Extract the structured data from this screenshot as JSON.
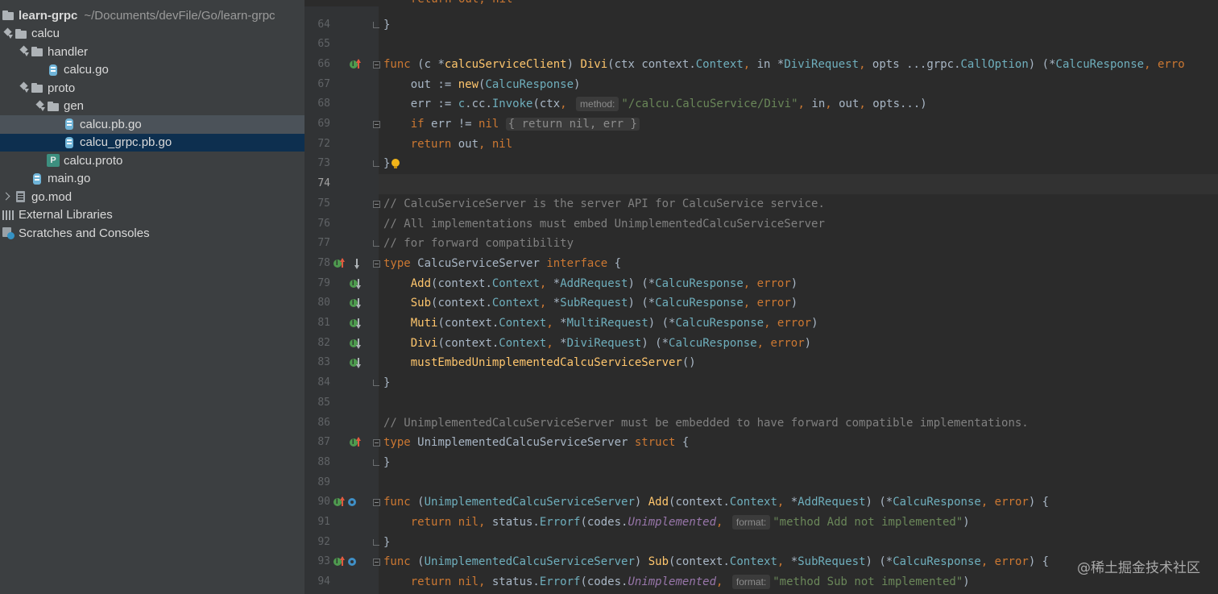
{
  "project": {
    "root_name": "learn-grpc",
    "root_path": "~/Documents/devFile/Go/learn-grpc",
    "tree": [
      {
        "label": "calcu",
        "kind": "folder",
        "arrow": "down",
        "depth": 0
      },
      {
        "label": "handler",
        "kind": "folder",
        "arrow": "down",
        "depth": 1
      },
      {
        "label": "calcu.go",
        "kind": "go",
        "arrow": "",
        "depth": 2
      },
      {
        "label": "proto",
        "kind": "folder",
        "arrow": "down",
        "depth": 1
      },
      {
        "label": "gen",
        "kind": "folder",
        "arrow": "down",
        "depth": 2
      },
      {
        "label": "calcu.pb.go",
        "kind": "go",
        "arrow": "",
        "depth": 3,
        "state": "sel-light"
      },
      {
        "label": "calcu_grpc.pb.go",
        "kind": "go",
        "arrow": "",
        "depth": 3,
        "state": "sel"
      },
      {
        "label": "calcu.proto",
        "kind": "proto",
        "arrow": "",
        "depth": 2
      },
      {
        "label": "main.go",
        "kind": "go",
        "arrow": "",
        "depth": 1
      },
      {
        "label": "go.mod",
        "kind": "mod",
        "arrow": "right",
        "depth": 0
      },
      {
        "label": "External Libraries",
        "kind": "lib",
        "arrow": "",
        "depth": -1
      },
      {
        "label": "Scratches and Consoles",
        "kind": "scratch",
        "arrow": "",
        "depth": -1
      }
    ]
  },
  "editor": {
    "top_partial": "return out, nil",
    "lines": [
      {
        "n": "64",
        "g": [],
        "fold": "end",
        "code": [
          [
            "p",
            "}"
          ]
        ]
      },
      {
        "n": "65",
        "g": [],
        "code": []
      },
      {
        "n": "66",
        "g": [
          "impl",
          "up"
        ],
        "fold": "open",
        "code": [
          [
            "kw",
            "func "
          ],
          [
            "p",
            "(c *"
          ],
          [
            "fn",
            "calcuServiceClient"
          ],
          [
            "p",
            ") "
          ],
          [
            "fn",
            "Divi"
          ],
          [
            "p",
            "(ctx context."
          ],
          [
            "ty",
            "Context"
          ],
          [
            "kw",
            ", "
          ],
          [
            "p",
            "in *"
          ],
          [
            "ty",
            "DiviRequest"
          ],
          [
            "kw",
            ", "
          ],
          [
            "p",
            "opts ...grpc."
          ],
          [
            "ty",
            "CallOption"
          ],
          [
            "p",
            ") (*"
          ],
          [
            "ty",
            "CalcuResponse"
          ],
          [
            "kw",
            ", erro"
          ]
        ]
      },
      {
        "n": "67",
        "g": [],
        "code": [
          [
            "p",
            "    out := "
          ],
          [
            "fn",
            "new"
          ],
          [
            "p",
            "("
          ],
          [
            "ty",
            "CalcuResponse"
          ],
          [
            "p",
            ")"
          ]
        ]
      },
      {
        "n": "68",
        "g": [],
        "code": [
          [
            "p",
            "    err := "
          ],
          [
            "ty",
            "c"
          ],
          [
            "p",
            ".cc."
          ],
          [
            "ty",
            "Invoke"
          ],
          [
            "p",
            "(ctx"
          ],
          [
            "kw",
            ", "
          ],
          [
            "hint",
            "method:"
          ],
          [
            "st",
            "\"/calcu.CalcuService/Divi\""
          ],
          [
            "kw",
            ", "
          ],
          [
            "p",
            "in"
          ],
          [
            "kw",
            ", "
          ],
          [
            "p",
            "out"
          ],
          [
            "kw",
            ", "
          ],
          [
            "p",
            "opts...)"
          ]
        ]
      },
      {
        "n": "69",
        "g": [],
        "fold": "open",
        "code": [
          [
            "kw",
            "    if "
          ],
          [
            "p",
            "err != "
          ],
          [
            "kw",
            "nil "
          ],
          [
            "fold",
            "{ return nil, err }"
          ]
        ]
      },
      {
        "n": "72",
        "g": [],
        "code": [
          [
            "kw",
            "    return "
          ],
          [
            "p",
            "out"
          ],
          [
            "kw",
            ", nil"
          ]
        ]
      },
      {
        "n": "73",
        "g": [],
        "fold": "end",
        "bulb": true,
        "code": [
          [
            "p",
            "}"
          ]
        ]
      },
      {
        "n": "74",
        "g": [],
        "caret": true,
        "code": []
      },
      {
        "n": "75",
        "g": [],
        "fold": "open",
        "code": [
          [
            "cm",
            "// CalcuServiceServer is the server API for CalcuService service."
          ]
        ]
      },
      {
        "n": "76",
        "g": [],
        "code": [
          [
            "cm",
            "// All implementations must embed UnimplementedCalcuServiceServer"
          ]
        ]
      },
      {
        "n": "77",
        "g": [],
        "fold": "end",
        "code": [
          [
            "cm",
            "// for forward compatibility"
          ]
        ]
      },
      {
        "n": "78",
        "g": [
          "impl",
          "up",
          "down"
        ],
        "fold": "open",
        "code": [
          [
            "kw",
            "type "
          ],
          [
            "p",
            "CalcuServiceServer "
          ],
          [
            "kw",
            "interface "
          ],
          [
            "p",
            "{"
          ]
        ]
      },
      {
        "n": "79",
        "g": [
          "impl",
          "down"
        ],
        "code": [
          [
            "fn",
            "    Add"
          ],
          [
            "p",
            "(context."
          ],
          [
            "ty",
            "Context"
          ],
          [
            "kw",
            ", "
          ],
          [
            "p",
            "*"
          ],
          [
            "ty",
            "AddRequest"
          ],
          [
            "p",
            ") (*"
          ],
          [
            "ty",
            "CalcuResponse"
          ],
          [
            "kw",
            ", error"
          ],
          [
            "p",
            ")"
          ]
        ]
      },
      {
        "n": "80",
        "g": [
          "impl",
          "down"
        ],
        "code": [
          [
            "fn",
            "    Sub"
          ],
          [
            "p",
            "(context."
          ],
          [
            "ty",
            "Context"
          ],
          [
            "kw",
            ", "
          ],
          [
            "p",
            "*"
          ],
          [
            "ty",
            "SubRequest"
          ],
          [
            "p",
            ") (*"
          ],
          [
            "ty",
            "CalcuResponse"
          ],
          [
            "kw",
            ", error"
          ],
          [
            "p",
            ")"
          ]
        ]
      },
      {
        "n": "81",
        "g": [
          "impl",
          "down"
        ],
        "code": [
          [
            "fn",
            "    Muti"
          ],
          [
            "p",
            "(context."
          ],
          [
            "ty",
            "Context"
          ],
          [
            "kw",
            ", "
          ],
          [
            "p",
            "*"
          ],
          [
            "ty",
            "MultiRequest"
          ],
          [
            "p",
            ") (*"
          ],
          [
            "ty",
            "CalcuResponse"
          ],
          [
            "kw",
            ", error"
          ],
          [
            "p",
            ")"
          ]
        ]
      },
      {
        "n": "82",
        "g": [
          "impl",
          "down"
        ],
        "code": [
          [
            "fn",
            "    Divi"
          ],
          [
            "p",
            "(context."
          ],
          [
            "ty",
            "Context"
          ],
          [
            "kw",
            ", "
          ],
          [
            "p",
            "*"
          ],
          [
            "ty",
            "DiviRequest"
          ],
          [
            "p",
            ") (*"
          ],
          [
            "ty",
            "CalcuResponse"
          ],
          [
            "kw",
            ", error"
          ],
          [
            "p",
            ")"
          ]
        ]
      },
      {
        "n": "83",
        "g": [
          "impl",
          "down"
        ],
        "code": [
          [
            "fn",
            "    mustEmbedUnimplementedCalcuServiceServer"
          ],
          [
            "p",
            "()"
          ]
        ]
      },
      {
        "n": "84",
        "g": [],
        "fold": "end",
        "code": [
          [
            "p",
            "}"
          ]
        ]
      },
      {
        "n": "85",
        "g": [],
        "code": []
      },
      {
        "n": "86",
        "g": [],
        "code": [
          [
            "cm",
            "// UnimplementedCalcuServiceServer must be embedded to have forward compatible implementations."
          ]
        ]
      },
      {
        "n": "87",
        "g": [
          "impl",
          "up"
        ],
        "fold": "open",
        "code": [
          [
            "kw",
            "type "
          ],
          [
            "p",
            "UnimplementedCalcuServiceServer "
          ],
          [
            "kw",
            "struct "
          ],
          [
            "p",
            "{"
          ]
        ]
      },
      {
        "n": "88",
        "g": [],
        "fold": "end",
        "code": [
          [
            "p",
            "}"
          ]
        ]
      },
      {
        "n": "89",
        "g": [],
        "code": []
      },
      {
        "n": "90",
        "g": [
          "impl",
          "up",
          "ovr"
        ],
        "fold": "open",
        "code": [
          [
            "kw",
            "func "
          ],
          [
            "p",
            "("
          ],
          [
            "ty",
            "UnimplementedCalcuServiceServer"
          ],
          [
            "p",
            ") "
          ],
          [
            "fn",
            "Add"
          ],
          [
            "p",
            "(context."
          ],
          [
            "ty",
            "Context"
          ],
          [
            "kw",
            ", "
          ],
          [
            "p",
            "*"
          ],
          [
            "ty",
            "AddRequest"
          ],
          [
            "p",
            ") (*"
          ],
          [
            "ty",
            "CalcuResponse"
          ],
          [
            "kw",
            ", error"
          ],
          [
            "p",
            ") {"
          ]
        ]
      },
      {
        "n": "91",
        "g": [],
        "code": [
          [
            "kw",
            "    return nil, "
          ],
          [
            "p",
            "status."
          ],
          [
            "ty",
            "Errorf"
          ],
          [
            "p",
            "(codes."
          ],
          [
            "it",
            "Unimplemented"
          ],
          [
            "kw",
            ", "
          ],
          [
            "hint",
            "format:"
          ],
          [
            "st",
            "\"method Add not implemented\""
          ],
          [
            "p",
            ")"
          ]
        ]
      },
      {
        "n": "92",
        "g": [],
        "fold": "end",
        "code": [
          [
            "p",
            "}"
          ]
        ]
      },
      {
        "n": "93",
        "g": [
          "impl",
          "up",
          "ovr"
        ],
        "fold": "open",
        "code": [
          [
            "kw",
            "func "
          ],
          [
            "p",
            "("
          ],
          [
            "ty",
            "UnimplementedCalcuServiceServer"
          ],
          [
            "p",
            ") "
          ],
          [
            "fn",
            "Sub"
          ],
          [
            "p",
            "(context."
          ],
          [
            "ty",
            "Context"
          ],
          [
            "kw",
            ", "
          ],
          [
            "p",
            "*"
          ],
          [
            "ty",
            "SubRequest"
          ],
          [
            "p",
            ") (*"
          ],
          [
            "ty",
            "CalcuResponse"
          ],
          [
            "kw",
            ", error"
          ],
          [
            "p",
            ") {"
          ]
        ]
      },
      {
        "n": "94",
        "g": [],
        "code": [
          [
            "kw",
            "    return nil, "
          ],
          [
            "p",
            "status."
          ],
          [
            "ty",
            "Errorf"
          ],
          [
            "p",
            "(codes."
          ],
          [
            "it",
            "Unimplemented"
          ],
          [
            "kw",
            ", "
          ],
          [
            "hint",
            "format:"
          ],
          [
            "st",
            "\"method Sub not implemented\""
          ],
          [
            "p",
            ")"
          ]
        ]
      }
    ]
  },
  "watermark": "@稀土掘金技术社区",
  "colors": {
    "sidebar_bg": "#3c3f41",
    "editor_bg": "#2b2b2b",
    "gutter_bg": "#313335",
    "selection": "#0d2f4f",
    "keyword": "#cc7832",
    "function": "#ffc66d",
    "string": "#6a8759",
    "comment": "#808080",
    "type": "#6fafbd"
  }
}
